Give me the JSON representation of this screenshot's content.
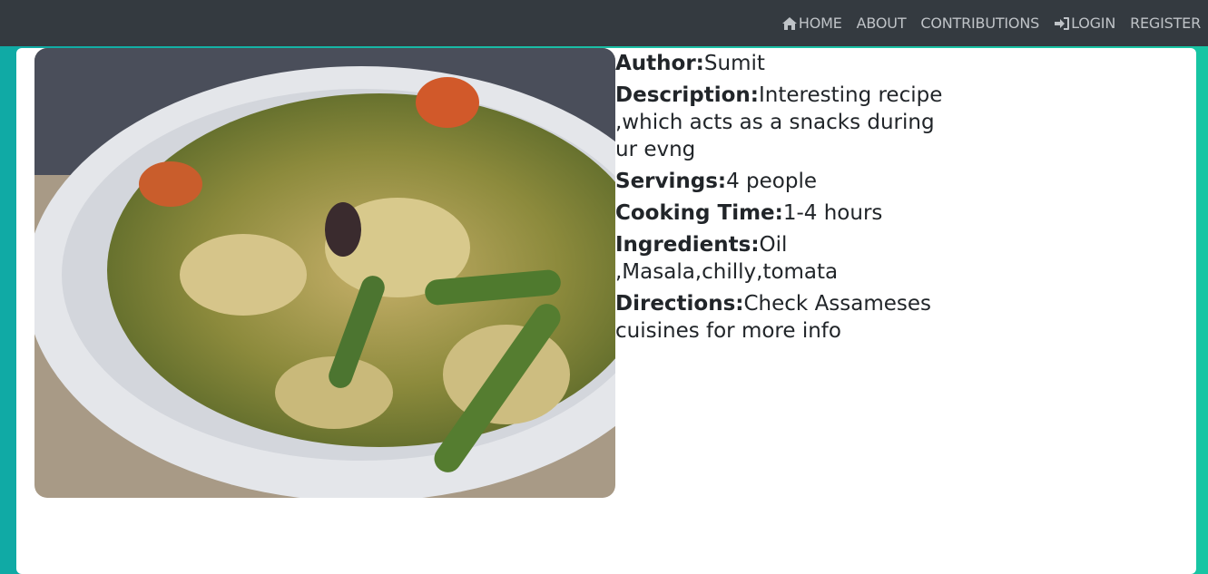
{
  "nav": {
    "home": "HOME",
    "about": "ABOUT",
    "contributions": "CONTRIBUTIONS",
    "login": "LOGIN",
    "register": "REGISTER"
  },
  "recipe": {
    "author_label": "Author:",
    "author": "Sumit",
    "description_label": "Description:",
    "description": "Interesting recipe ,which acts as a snacks during ur evng",
    "servings_label": "Servings:",
    "servings": "4 people",
    "cooking_time_label": "Cooking Time:",
    "cooking_time": "1-4 hours",
    "ingredients_label": "Ingredients:",
    "ingredients": "Oil ,Masala,chilly,tomata",
    "directions_label": "Directions:",
    "directions": "Check Assameses cuisines for more info"
  },
  "icons": {
    "home": "home-icon",
    "login": "sign-in-icon"
  },
  "colors": {
    "navbar": "#343a40",
    "nav_text": "#bfc3c7",
    "background_teal": "#10aaa5",
    "card": "#ffffff",
    "text": "#212529"
  }
}
